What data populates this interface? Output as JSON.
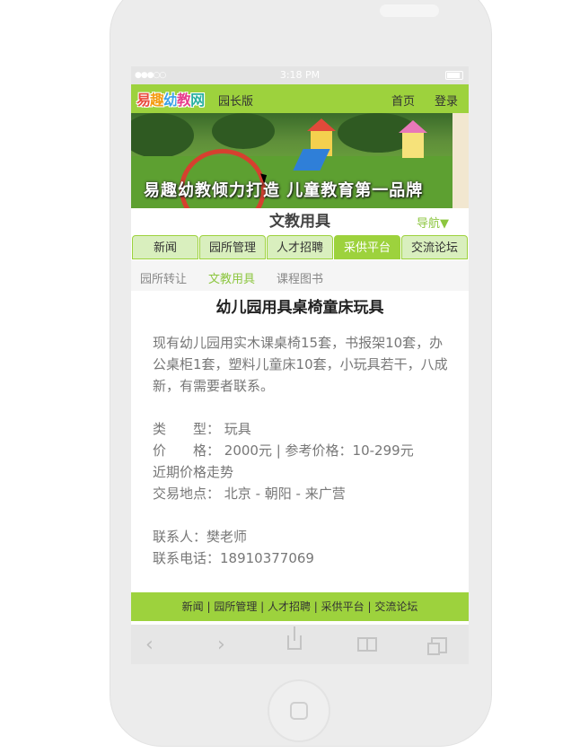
{
  "status": {
    "time": "3:18 PM",
    "signal": "●●●○○"
  },
  "header": {
    "logo": [
      "易",
      "趣",
      "幼",
      "教",
      "网"
    ],
    "logo_colors": [
      "#e94b3c",
      "#f39c12",
      "#3aa0e8",
      "#e83e8c",
      "#2ab0a0"
    ],
    "edition": "园长版",
    "home_link": "首页",
    "login_link": "登录"
  },
  "banner": {
    "slogan": "易趣幼教倾力打造 儿童教育第一品牌"
  },
  "page": {
    "title": "文教用具",
    "nav_toggle": "导航▼"
  },
  "tabs": [
    {
      "label": "新闻",
      "active": false
    },
    {
      "label": "园所管理",
      "active": false
    },
    {
      "label": "人才招聘",
      "active": false
    },
    {
      "label": "采供平台",
      "active": true
    },
    {
      "label": "交流论坛",
      "active": false
    }
  ],
  "subnav": [
    {
      "label": "园所转让",
      "active": false
    },
    {
      "label": "文教用具",
      "active": true
    },
    {
      "label": "课程图书",
      "active": false
    }
  ],
  "article": {
    "title": "幼儿园用具桌椅童床玩具",
    "description": "现有幼儿园用实木课桌椅15套，书报架10套，办公桌柜1套，塑料儿童床10套，小玩具若干，八成新，有需要者联系。",
    "type_label": "类　　型：",
    "type_value": "玩具",
    "price_label": "价　　格：",
    "price_value": "2000元 | 参考价格：10-299元",
    "trend_link": "近期价格走势",
    "location_label": "交易地点：",
    "location_value": "北京 - 朝阳 - 来广营",
    "contact": "联系人：樊老师",
    "phone": "联系电话：18910377069"
  },
  "footer": {
    "links": "新闻 | 园所管理 | 人才招聘 | 采供平台 | 交流论坛"
  },
  "toolbar": {
    "back": "‹",
    "forward": "›"
  }
}
